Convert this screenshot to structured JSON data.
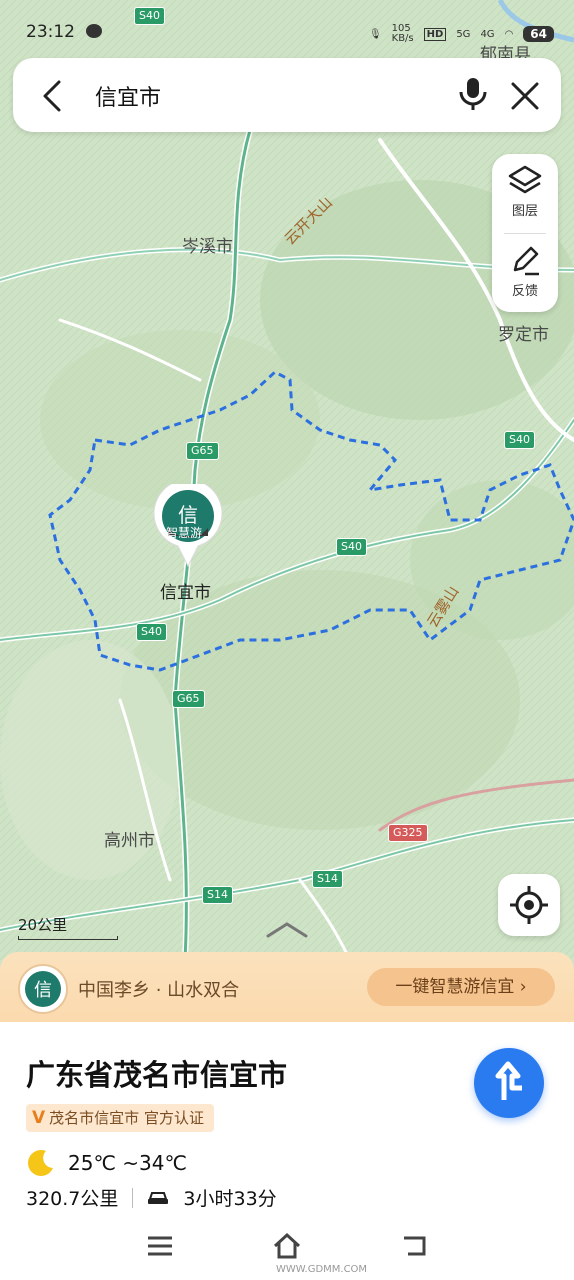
{
  "status_bar": {
    "time": "23:12",
    "net_speed": "105\nKB/s",
    "hd": "HD",
    "sim": "5G",
    "sim2": "4G",
    "battery": "64"
  },
  "search": {
    "query": "信宜市",
    "back_icon": "chevron-left-icon",
    "mic_icon": "microphone-icon",
    "close_icon": "close-icon"
  },
  "tools": {
    "layers_label": "图层",
    "feedback_label": "反馈"
  },
  "map": {
    "labels": {
      "cenxi": "岑溪市",
      "luoding": "罗定市",
      "gaozhou": "高州市",
      "xinyi": "信宜市",
      "yunkai": "云开大山",
      "yunwu": "云雾山",
      "yunan": "郁南县",
      "poi_badge": "智慧游"
    },
    "roads": {
      "s40": "S40",
      "g65": "G65",
      "s14": "S14",
      "g325": "G325"
    },
    "scale": "20公里",
    "colors": {
      "boundary": "#2b6fe0",
      "land": "#cfe3c6",
      "road": "#ffffff"
    }
  },
  "promo": {
    "slogan": "中国李乡 · 山水双合",
    "cta": "一键智慧游信宜"
  },
  "place": {
    "title": "广东省茂名市信宜市",
    "cert": "茂名市信宜市 官方认证",
    "cert_mark": "V",
    "weather": "25℃ ~34℃",
    "weather_icon": "moon-icon",
    "distance": "320.7公里",
    "duration": "3小时33分",
    "car_icon": "car-icon",
    "go_icon": "navigate-arrow-icon"
  },
  "watermark": "WWW.GDMM.COM"
}
